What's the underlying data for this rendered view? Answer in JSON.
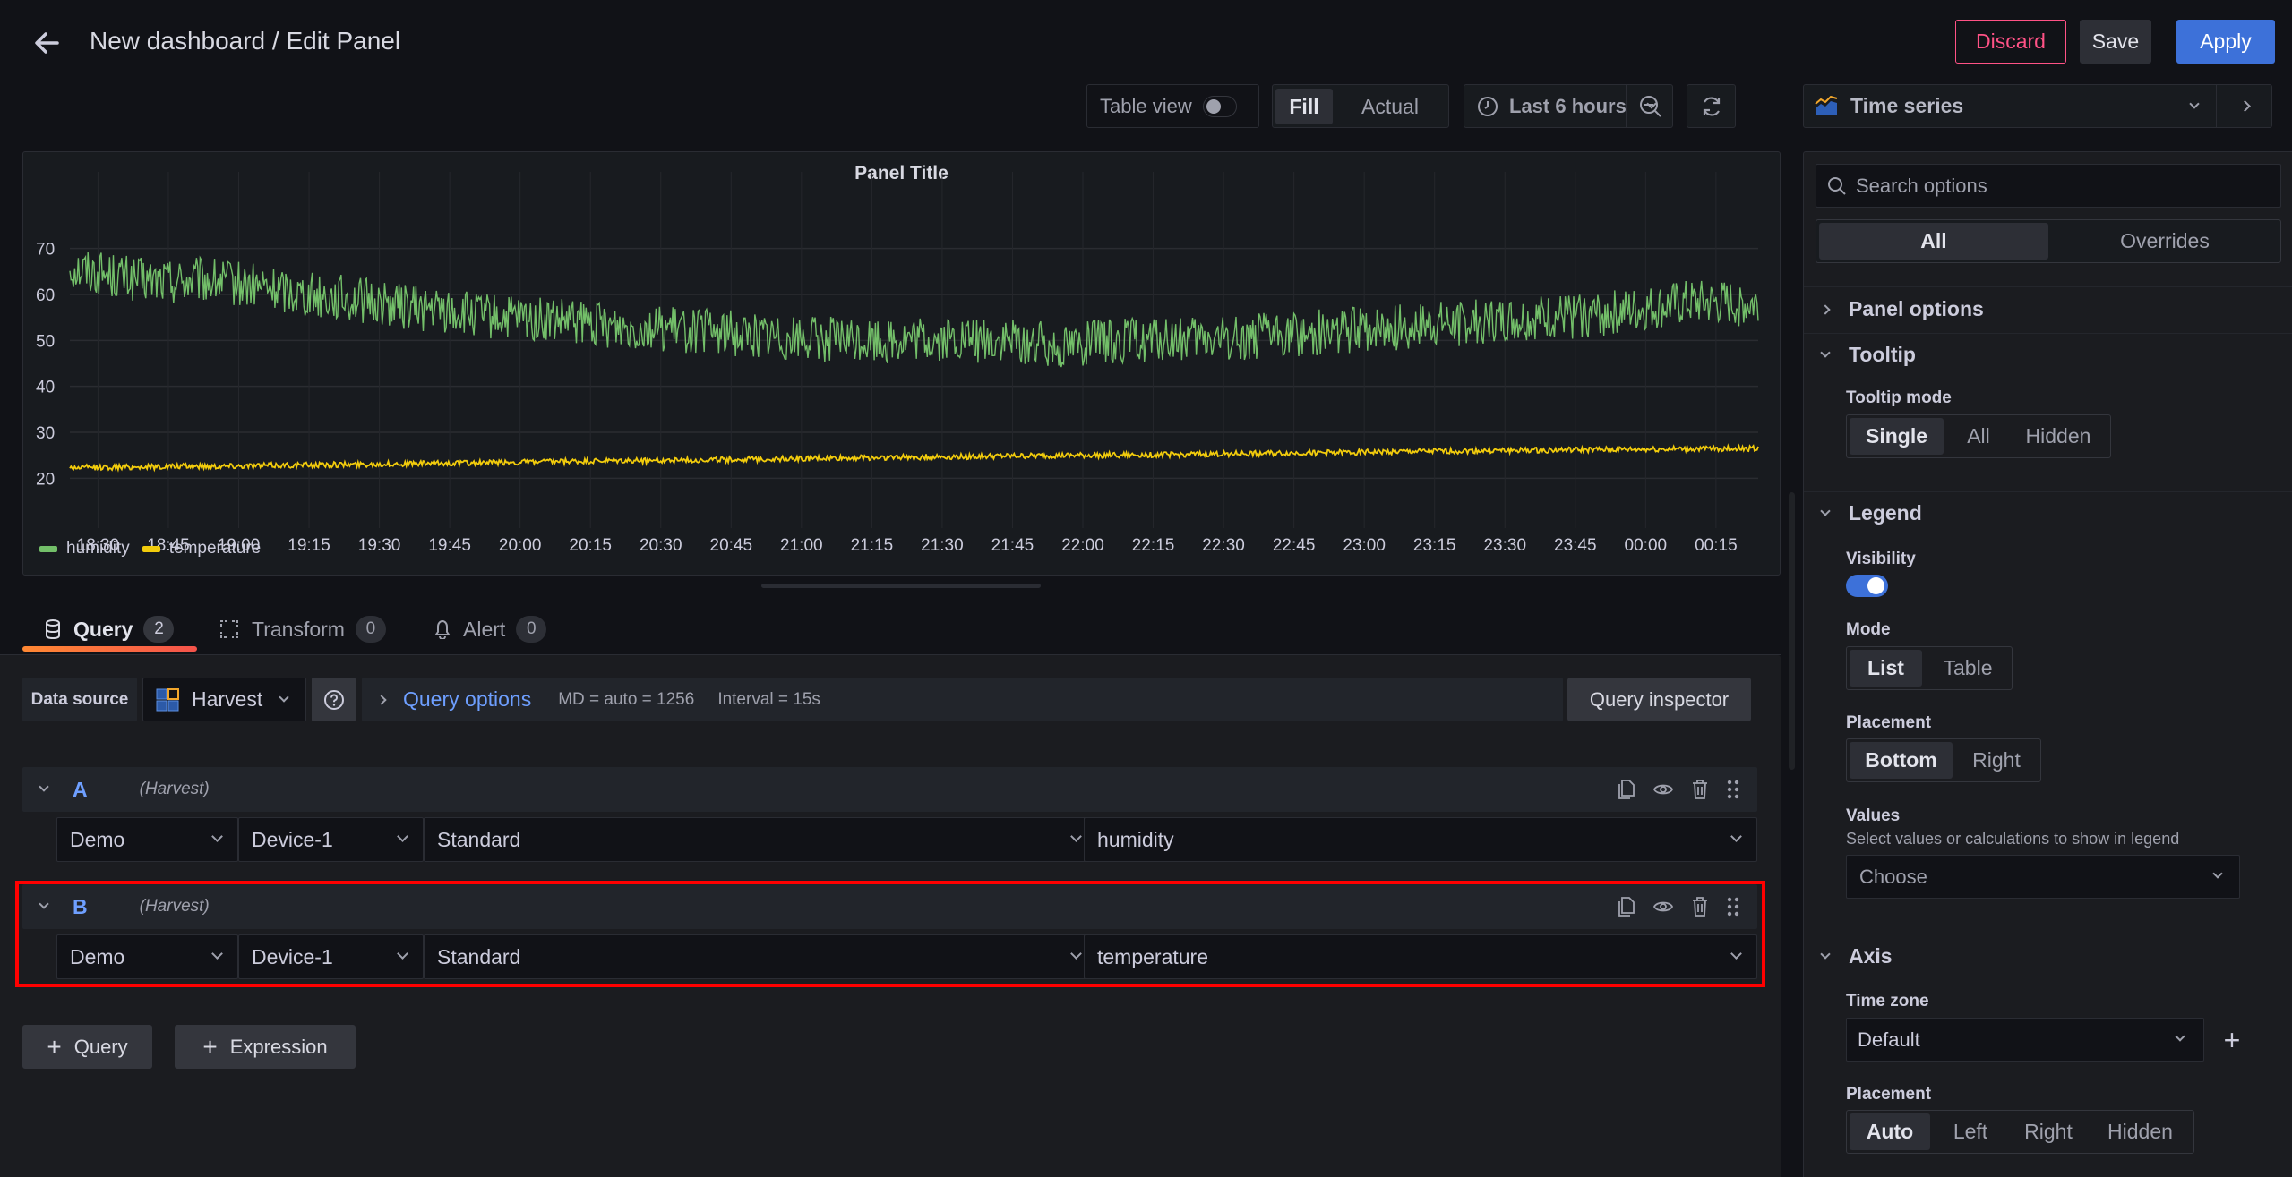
{
  "header": {
    "title": "New dashboard / Edit Panel",
    "discard_label": "Discard",
    "save_label": "Save",
    "apply_label": "Apply"
  },
  "toolbar": {
    "table_view_label": "Table view",
    "table_view_on": false,
    "fill_label": "Fill",
    "actual_label": "Actual",
    "time_range": "Last 6 hours",
    "visualization": "Time series"
  },
  "panel": {
    "title": "Panel Title"
  },
  "chart_data": {
    "type": "line",
    "title": "Panel Title",
    "xlabel": "",
    "ylabel": "",
    "ylim": [
      15,
      75
    ],
    "yticks": [
      20,
      30,
      40,
      50,
      60,
      70
    ],
    "xticks": [
      "18:30",
      "18:45",
      "19:00",
      "19:15",
      "19:30",
      "19:45",
      "20:00",
      "20:15",
      "20:30",
      "20:45",
      "21:00",
      "21:15",
      "21:30",
      "21:45",
      "22:00",
      "22:15",
      "22:30",
      "22:45",
      "23:00",
      "23:15",
      "23:30",
      "23:45",
      "00:00",
      "00:15"
    ],
    "x_range": [
      "18:24",
      "00:24"
    ],
    "grid": true,
    "legend_placement": "bottom-left",
    "series": [
      {
        "name": "humidity",
        "color": "#73bf69",
        "trend": [
          [
            0,
            66
          ],
          [
            1,
            63
          ],
          [
            2,
            63
          ],
          [
            3,
            61
          ],
          [
            4,
            59
          ],
          [
            5,
            57
          ],
          [
            6,
            55
          ],
          [
            7,
            54
          ],
          [
            8,
            53
          ],
          [
            9,
            52
          ],
          [
            10,
            51
          ],
          [
            11,
            50
          ],
          [
            12,
            50
          ],
          [
            13,
            50
          ],
          [
            14,
            49
          ],
          [
            15,
            50
          ],
          [
            16,
            50
          ],
          [
            17,
            51
          ],
          [
            18,
            52
          ],
          [
            19,
            53
          ],
          [
            20,
            54
          ],
          [
            21,
            55
          ],
          [
            22,
            56
          ],
          [
            23,
            58
          ],
          [
            24,
            58
          ]
        ],
        "noise_amplitude": 5
      },
      {
        "name": "temperature",
        "color": "#f2cc0c",
        "trend": [
          [
            0,
            22.3
          ],
          [
            4,
            23
          ],
          [
            8,
            23.8
          ],
          [
            12,
            24.6
          ],
          [
            16,
            25.2
          ],
          [
            20,
            26
          ],
          [
            24,
            26.5
          ]
        ],
        "noise_amplitude": 0.6
      }
    ]
  },
  "tabs": [
    {
      "label": "Query",
      "count": "2",
      "active": true
    },
    {
      "label": "Transform",
      "count": "0",
      "active": false
    },
    {
      "label": "Alert",
      "count": "0",
      "active": false
    }
  ],
  "datasource": {
    "label": "Data source",
    "value": "Harvest",
    "query_options_label": "Query options",
    "md": "MD = auto = 1256",
    "interval": "Interval = 15s",
    "inspector_label": "Query inspector"
  },
  "queries": [
    {
      "ref": "A",
      "source": "(Harvest)",
      "fields": [
        "Demo",
        "Device-1",
        "Standard",
        "humidity"
      ],
      "highlighted": false
    },
    {
      "ref": "B",
      "source": "(Harvest)",
      "fields": [
        "Demo",
        "Device-1",
        "Standard",
        "temperature"
      ],
      "highlighted": true
    }
  ],
  "add_buttons": {
    "query_label": "Query",
    "expression_label": "Expression"
  },
  "options": {
    "search_placeholder": "Search options",
    "tab_all": "All",
    "tab_overrides": "Overrides",
    "panel_options": "Panel options",
    "tooltip": {
      "title": "Tooltip",
      "mode_label": "Tooltip mode",
      "modes": [
        "Single",
        "All",
        "Hidden"
      ],
      "selected": "Single"
    },
    "legend": {
      "title": "Legend",
      "visibility_label": "Visibility",
      "visibility_on": true,
      "mode_label": "Mode",
      "modes": [
        "List",
        "Table"
      ],
      "mode_selected": "List",
      "placement_label": "Placement",
      "placements": [
        "Bottom",
        "Right"
      ],
      "placement_selected": "Bottom",
      "values_label": "Values",
      "values_description": "Select values or calculations to show in legend",
      "values_placeholder": "Choose"
    },
    "axis": {
      "title": "Axis",
      "timezone_label": "Time zone",
      "timezone_value": "Default",
      "placement_label": "Placement",
      "placements": [
        "Auto",
        "Left",
        "Right",
        "Hidden"
      ],
      "placement_selected": "Auto"
    }
  },
  "colors": {
    "accent_blue": "#3d71d9",
    "discard_red": "#ff5286",
    "highlight_red": "#ff0000",
    "tab_underline": "#ff7a3d",
    "link_blue": "#6e9fff",
    "query_ref_blue": "#6e9fff"
  }
}
